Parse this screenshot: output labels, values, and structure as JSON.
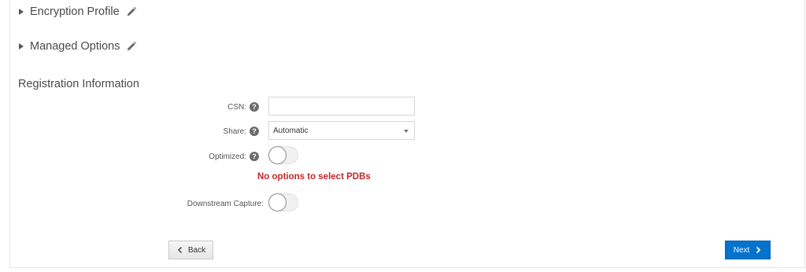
{
  "sections": {
    "encryption_profile": "Encryption Profile",
    "managed_options": "Managed Options"
  },
  "registration": {
    "title": "Registration Information",
    "csn_label": "CSN:",
    "csn_value": "",
    "share_label": "Share:",
    "share_value": "Automatic",
    "optimized_label": "Optimized:",
    "optimized_on": false,
    "pdb_warning": "No options to select PDBs",
    "downstream_label": "Downstream Capture:",
    "downstream_on": false,
    "help_glyph": "?"
  },
  "footer": {
    "back_label": "Back",
    "next_label": "Next"
  },
  "colors": {
    "primary": "#0572ce",
    "warning": "#c0282a"
  }
}
